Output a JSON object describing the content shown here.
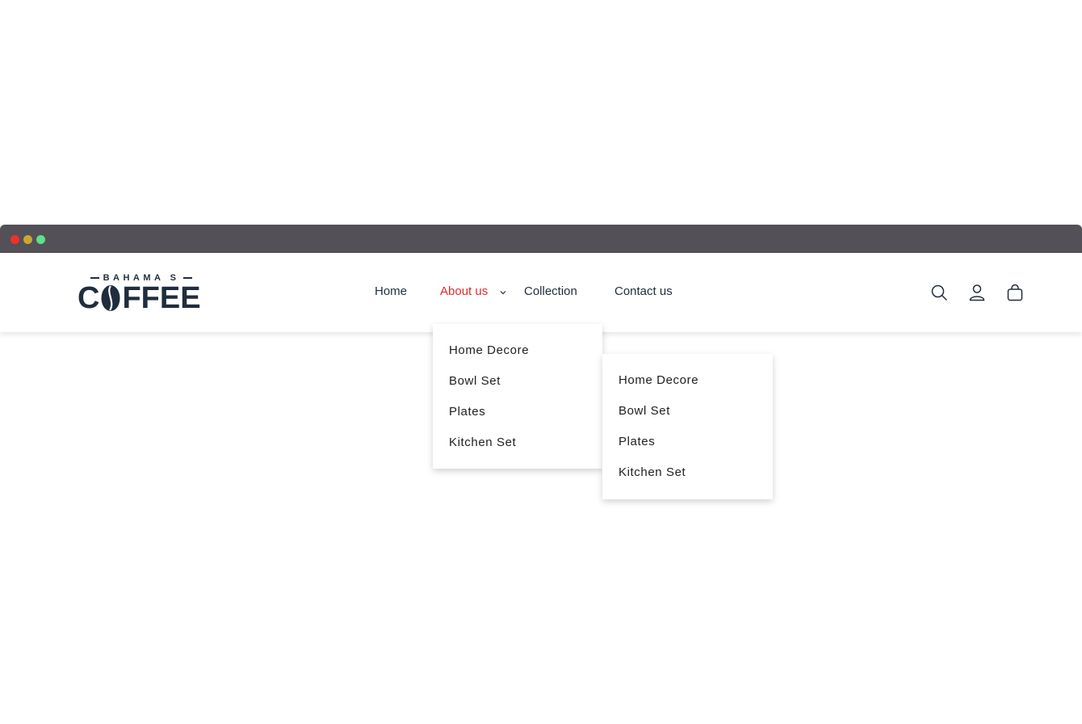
{
  "window": {
    "dots": [
      "#f0302a",
      "#c9a830",
      "#5ee08c"
    ]
  },
  "logo": {
    "top_text": "BAHAMA S",
    "main_text_left": "C",
    "main_text_right": "FFEE",
    "color": "#1f2d3d"
  },
  "nav": {
    "items": [
      {
        "label": "Home"
      },
      {
        "label": "About us",
        "active": true
      },
      {
        "label": "Collection"
      },
      {
        "label": "Contact us"
      }
    ],
    "active_color": "#e12b2b",
    "text_color": "#1f2d3d"
  },
  "icons": [
    "search-icon",
    "user-icon",
    "bag-icon"
  ],
  "dropdown": {
    "items": [
      {
        "label": "Home Decore"
      },
      {
        "label": "Bowl Set"
      },
      {
        "label": "Plates"
      },
      {
        "label": "Kitchen Set"
      }
    ]
  },
  "submenu": {
    "items": [
      {
        "label": "Home Decore"
      },
      {
        "label": "Bowl Set"
      },
      {
        "label": "Plates"
      },
      {
        "label": "Kitchen Set"
      }
    ]
  }
}
